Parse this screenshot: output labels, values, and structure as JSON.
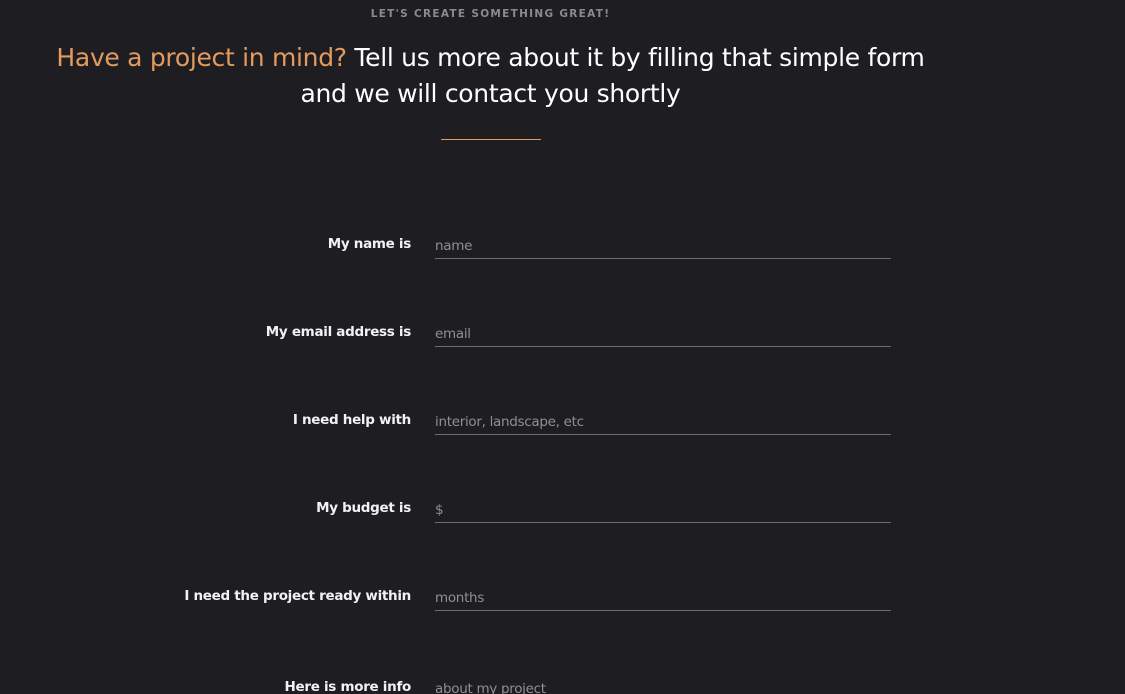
{
  "header": {
    "eyebrow": "LET'S CREATE SOMETHING GREAT!",
    "headline_accent": "Have a project in mind?",
    "headline_rest": " Tell us more about it by filling that simple form and we will contact you shortly"
  },
  "form": {
    "fields": [
      {
        "label": "My name is",
        "placeholder": "name",
        "value": ""
      },
      {
        "label": "My email address is",
        "placeholder": "email",
        "value": ""
      },
      {
        "label": "I need help with",
        "placeholder": "interior, landscape, etc",
        "value": ""
      },
      {
        "label": "My budget is",
        "placeholder": "$",
        "value": ""
      },
      {
        "label": "I need the project ready within",
        "placeholder": "months",
        "value": ""
      },
      {
        "label": "Here is more info",
        "placeholder": "about my project",
        "value": ""
      }
    ]
  },
  "colors": {
    "background": "#1e1e22",
    "accent": "#e39a5e",
    "text": "#ffffff",
    "muted": "#8a8a8f",
    "underline": "#6a6a70"
  }
}
